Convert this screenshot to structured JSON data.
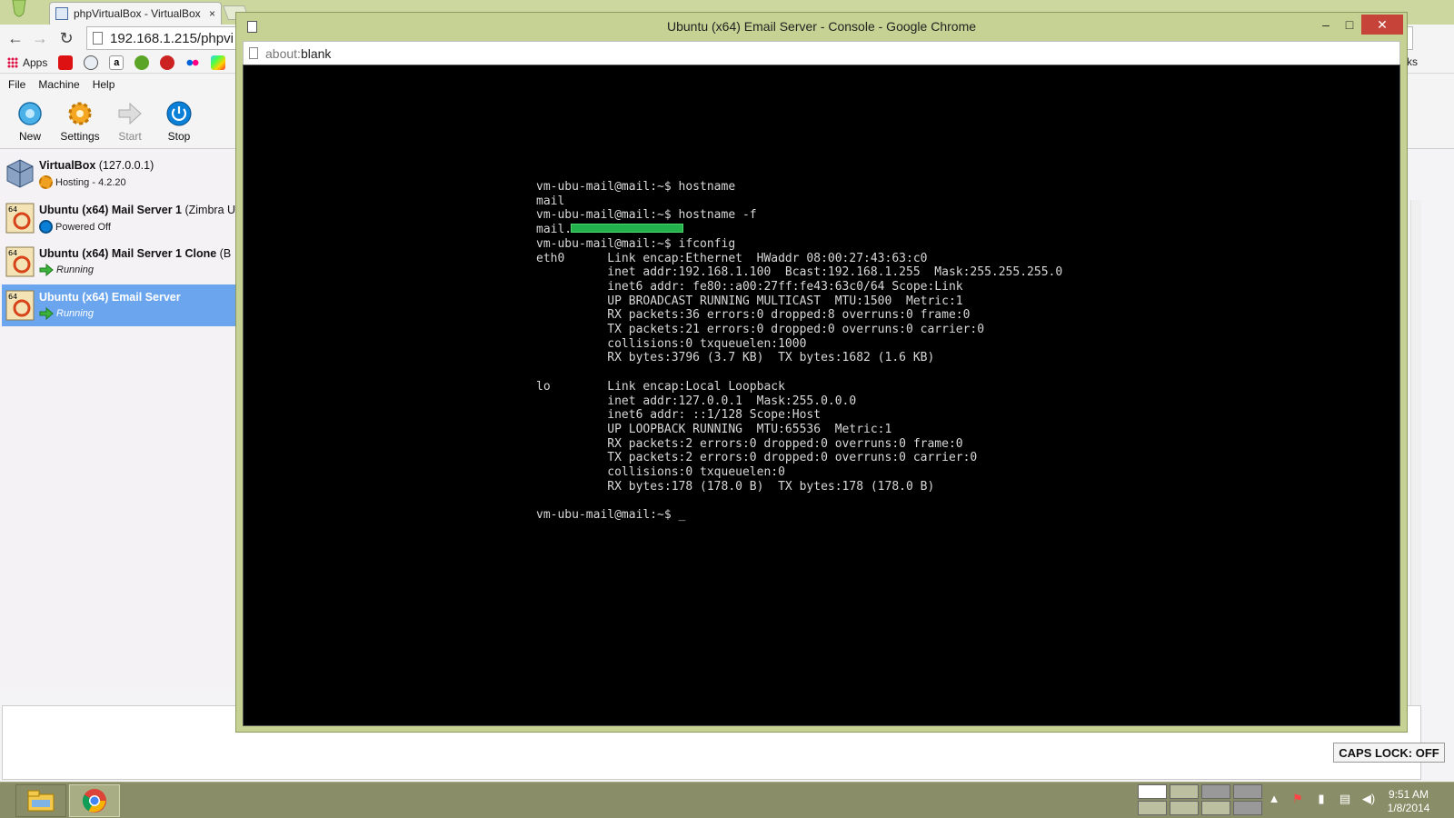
{
  "background_browser": {
    "tab_title": "phpVirtualBox - VirtualBox",
    "tab_close": "×",
    "address": "192.168.1.215/phpvi",
    "bookmarks": {
      "apps_label": "Apps",
      "icons": [
        "youtube-icon",
        "reddit-icon",
        "amazon-icon",
        "evernote-icon",
        "lastfm-icon",
        "flickr-icon",
        "google-play-icon"
      ]
    },
    "right_edge_text": "ks"
  },
  "vbox": {
    "menu": [
      "File",
      "Machine",
      "Help"
    ],
    "toolbar": [
      {
        "label": "New",
        "enabled": true
      },
      {
        "label": "Settings",
        "enabled": true
      },
      {
        "label": "Start",
        "enabled": false
      },
      {
        "label": "Stop",
        "enabled": true
      }
    ],
    "vms": [
      {
        "name": "VirtualBox",
        "sub": " (127.0.0.1)",
        "status": "Hosting - 4.2.20",
        "status_style": "normal",
        "selected": false
      },
      {
        "name": "Ubuntu (x64) Mail Server 1",
        "sub": " (Zimbra U",
        "status": "Powered Off",
        "status_style": "normal",
        "selected": false
      },
      {
        "name": "Ubuntu (x64) Mail Server 1 Clone",
        "sub": " (B",
        "status": "Running",
        "status_style": "italic",
        "selected": false
      },
      {
        "name": "Ubuntu (x64) Email Server",
        "sub": "",
        "status": "Running",
        "status_style": "italic",
        "selected": true
      }
    ]
  },
  "popup": {
    "title": "Ubuntu (x64) Email Server - Console - Google Chrome",
    "address_scheme": "about:",
    "address_rest": "blank",
    "controls": {
      "minimize": "–",
      "maximize": "□",
      "close": "✕"
    }
  },
  "console": {
    "lines_before_redaction": "vm-ubu-mail@mail:~$ hostname\nmail\nvm-ubu-mail@mail:~$ hostname -f\nmail.",
    "lines_after_redaction": "\nvm-ubu-mail@mail:~$ ifconfig\neth0      Link encap:Ethernet  HWaddr 08:00:27:43:63:c0\n          inet addr:192.168.1.100  Bcast:192.168.1.255  Mask:255.255.255.0\n          inet6 addr: fe80::a00:27ff:fe43:63c0/64 Scope:Link\n          UP BROADCAST RUNNING MULTICAST  MTU:1500  Metric:1\n          RX packets:36 errors:0 dropped:8 overruns:0 frame:0\n          TX packets:21 errors:0 dropped:0 overruns:0 carrier:0\n          collisions:0 txqueuelen:1000\n          RX bytes:3796 (3.7 KB)  TX bytes:1682 (1.6 KB)\n\nlo        Link encap:Local Loopback\n          inet addr:127.0.0.1  Mask:255.0.0.0\n          inet6 addr: ::1/128 Scope:Host\n          UP LOOPBACK RUNNING  MTU:65536  Metric:1\n          RX packets:2 errors:0 dropped:0 overruns:0 frame:0\n          TX packets:2 errors:0 dropped:0 overruns:0 carrier:0\n          collisions:0 txqueuelen:0\n          RX bytes:178 (178.0 B)  TX bytes:178 (178.0 B)\n\nvm-ubu-mail@mail:~$ ",
    "cursor": "_"
  },
  "caps_lock": "CAPS LOCK: OFF",
  "taskbar": {
    "buttons": [
      "file-explorer-icon",
      "chrome-icon"
    ],
    "clock_time": "9:51 AM",
    "clock_date": "1/8/2014"
  }
}
